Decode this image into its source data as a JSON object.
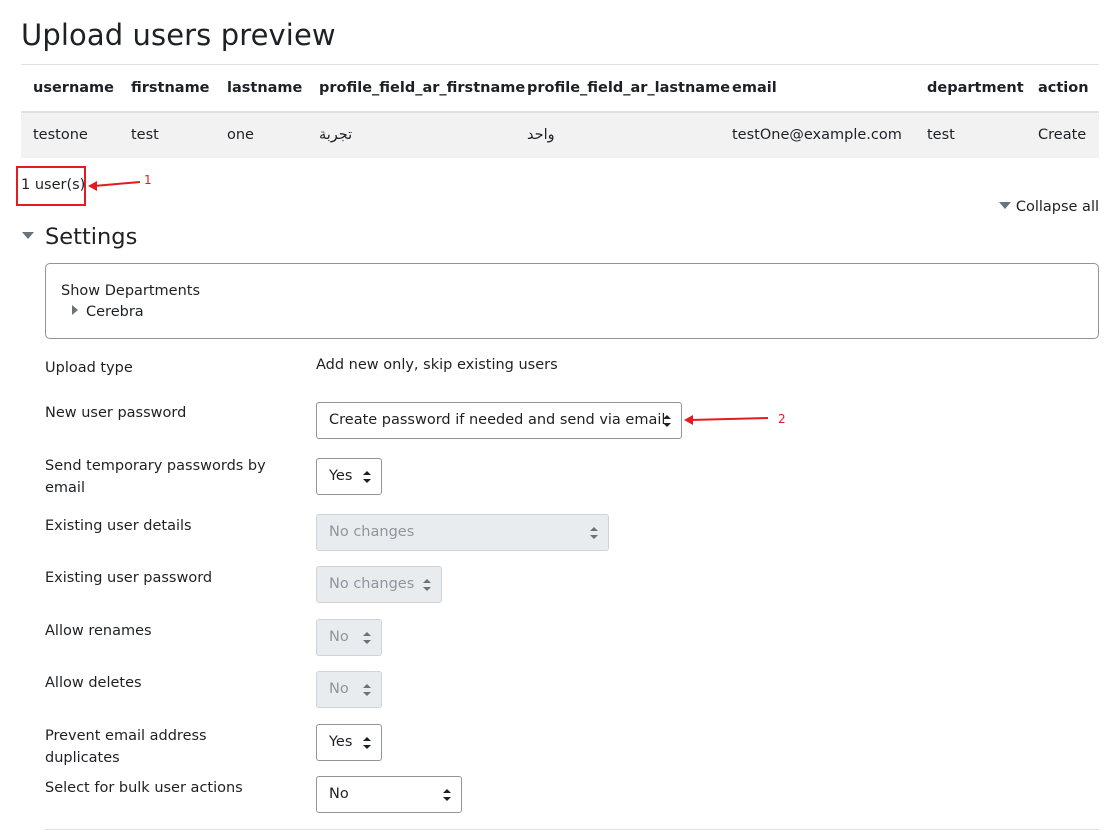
{
  "page": {
    "title": "Upload users preview"
  },
  "table": {
    "headers": [
      "username",
      "firstname",
      "lastname",
      "profile_field_ar_firstname",
      "profile_field_ar_lastname",
      "email",
      "department",
      "action"
    ],
    "rows": [
      [
        "testone",
        "test",
        "one",
        "تجربة",
        "واحد",
        "testOne@example.com",
        "test",
        "Create"
      ]
    ]
  },
  "summary": {
    "users_count": "1 user(s)"
  },
  "annotations": {
    "marker_1": "1",
    "marker_2": "2",
    "color": "#e31b23"
  },
  "collapse_all": {
    "label": "Collapse all"
  },
  "settings": {
    "heading": "Settings",
    "departments": {
      "label": "Show Departments",
      "node": "Cerebra"
    },
    "upload_type": {
      "label": "Upload type",
      "value": "Add new only, skip existing users"
    },
    "new_user_password": {
      "label": "New user password",
      "value": "Create password if needed and send via email"
    },
    "send_temp_passwords": {
      "label": "Send temporary passwords by email",
      "value": "Yes"
    },
    "existing_user_details": {
      "label": "Existing user details",
      "value": "No changes"
    },
    "existing_user_password": {
      "label": "Existing user password",
      "value": "No changes"
    },
    "allow_renames": {
      "label": "Allow renames",
      "value": "No"
    },
    "allow_deletes": {
      "label": "Allow deletes",
      "value": "No"
    },
    "prevent_email_duplicates": {
      "label": "Prevent email address duplicates",
      "value": "Yes"
    },
    "select_bulk": {
      "label": "Select for bulk user actions",
      "value": "No"
    }
  }
}
